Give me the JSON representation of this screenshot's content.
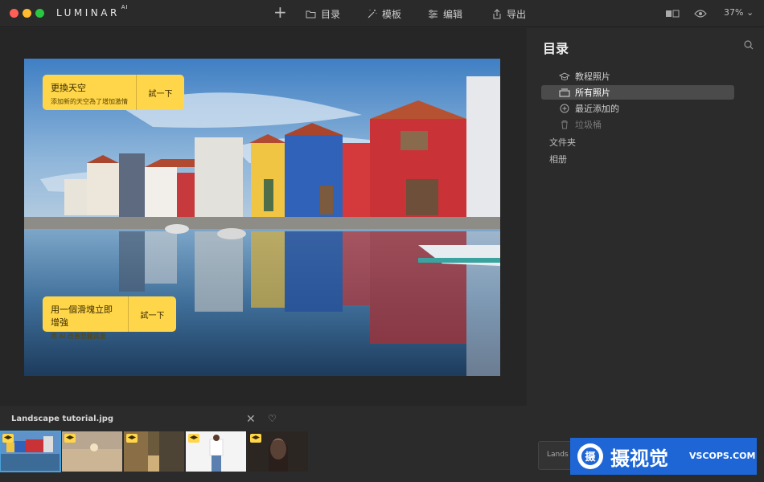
{
  "app": {
    "logo": "LUMINAR",
    "logo_sup": "AI",
    "zoom": "37%"
  },
  "toolbar": {
    "catalog": "目录",
    "templates": "模板",
    "edit": "编辑",
    "export": "导出"
  },
  "promos": [
    {
      "title": "更換天空",
      "subtitle": "添加新的天空為了增加激情",
      "button": "試一下"
    },
    {
      "title": "用一個滑塊立即增強",
      "subtitle": "用 AI 改善整體質量",
      "button": "試一下"
    }
  ],
  "filmstrip": {
    "filename": "Landscape tutorial.jpg",
    "thumbs": [
      {
        "name": "canal-houses",
        "selected": true
      },
      {
        "name": "beach-sunset",
        "selected": false
      },
      {
        "name": "city-street",
        "selected": false
      },
      {
        "name": "woman-white",
        "selected": false
      },
      {
        "name": "woman-portrait",
        "selected": false
      }
    ]
  },
  "panel": {
    "title": "目录",
    "items": [
      {
        "label": "教程照片",
        "icon": "graduation-cap-icon",
        "selected": false,
        "dim": false
      },
      {
        "label": "所有照片",
        "icon": "photos-stack-icon",
        "selected": true,
        "dim": false
      },
      {
        "label": "最近添加的",
        "icon": "plus-circle-icon",
        "selected": false,
        "dim": false
      },
      {
        "label": "垃圾桶",
        "icon": "trash-icon",
        "selected": false,
        "dim": true
      }
    ],
    "sections": [
      "文件夹",
      "相册"
    ],
    "card_text": "Lands"
  },
  "watermark": {
    "cn": "摄视觉",
    "en": "VSCOPS.COM"
  },
  "colors": {
    "accent": "#ffd64a",
    "selection": "#4aa0d8",
    "watermark": "#1e66d6"
  }
}
